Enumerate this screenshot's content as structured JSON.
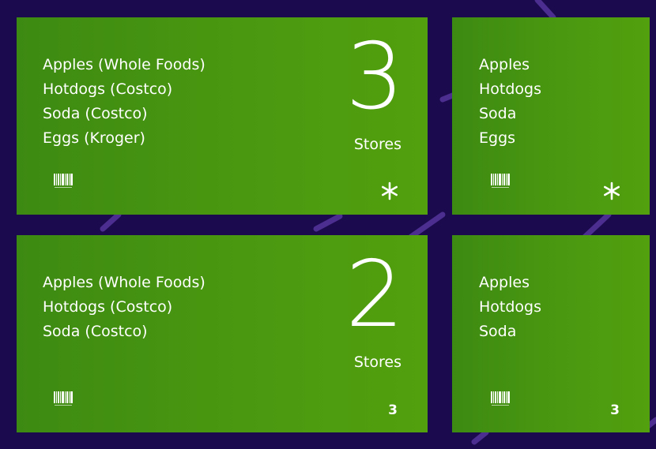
{
  "tiles": [
    {
      "items": [
        "Apples (Whole Foods)",
        "Hotdogs (Costco)",
        "Soda (Costco)",
        "Eggs (Kroger)"
      ],
      "store_count": "3",
      "store_label": "Stores",
      "barcode_icon": "barcode-icon",
      "badge_icon": "asterisk-icon"
    },
    {
      "items": [
        "Apples",
        "Hotdogs",
        "Soda",
        "Eggs"
      ],
      "barcode_icon": "barcode-icon",
      "badge_icon": "asterisk-icon"
    },
    {
      "items": [
        "Apples (Whole Foods)",
        "Hotdogs (Costco)",
        "Soda (Costco)"
      ],
      "store_count": "2",
      "store_label": "Stores",
      "barcode_icon": "barcode-icon",
      "badge_number": "3"
    },
    {
      "items": [
        "Apples",
        "Hotdogs",
        "Soda"
      ],
      "barcode_icon": "barcode-icon",
      "badge_number": "3"
    }
  ],
  "colors": {
    "background": "#1b0a4d",
    "tile": "#4a9810",
    "text": "#ffffff",
    "decor": "#5b3aa6"
  }
}
